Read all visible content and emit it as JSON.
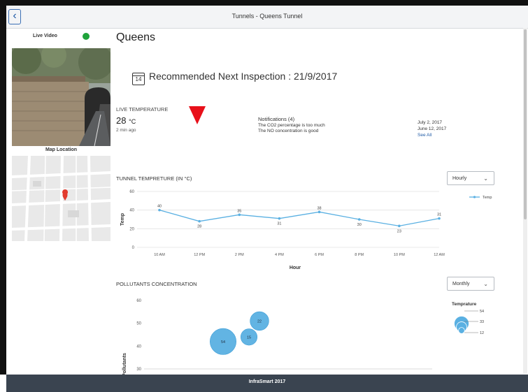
{
  "window": {
    "title": "Tunnels - Queens Tunnel",
    "back_icon": "chevron-left-icon"
  },
  "sidebar": {
    "live_video_label": "Live Video",
    "live_status_color": "#1fa33b",
    "map_label": "Map Location"
  },
  "header": {
    "city": "Queens",
    "inspection": "Recommended Next Inspection : 21/9/2017",
    "calendar_day": "14"
  },
  "live_temperature": {
    "title": "LIVE TEMPERATURE",
    "value": "28",
    "unit": "°C",
    "updated": "2 min ago",
    "trend_icon": "down-arrow-icon",
    "trend_color": "#e8101a"
  },
  "notifications": {
    "title": "Notifications (4)",
    "items": [
      "The CO2 percentage is too much",
      "The NO concentration is good"
    ],
    "dates": [
      "July 2, 2017",
      "June 12, 2017"
    ],
    "see_all": "See All"
  },
  "temperature_chart": {
    "title": "TUNNEL TEMPRETURE (IN °C)",
    "dropdown": "Hourly"
  },
  "pollutants_chart": {
    "title": "POLLUTANTS CONCENTRATION",
    "dropdown": "Monthly"
  },
  "footer": {
    "text": "InfraSmart 2017"
  },
  "chart_data": [
    {
      "type": "line",
      "x": [
        "10 AM",
        "12 PM",
        "2 PM",
        "4 PM",
        "6 PM",
        "8 PM",
        "10 PM",
        "12 AM"
      ],
      "series": [
        {
          "name": "Temp",
          "values": [
            40,
            28,
            35,
            31,
            38,
            30,
            23,
            31
          ]
        }
      ],
      "xlabel": "Hour",
      "ylabel": "Temp",
      "yticks": [
        0,
        20,
        40,
        60
      ],
      "ylim": [
        0,
        60
      ],
      "grid": true,
      "legend": "top-right",
      "color": "#5ab0e2"
    },
    {
      "type": "scatter",
      "points": [
        {
          "x": 1,
          "y": 42,
          "size": 54,
          "label": "54"
        },
        {
          "x": 2,
          "y": 44,
          "size": 15,
          "label": "15"
        },
        {
          "x": 3,
          "y": 51,
          "size": 22,
          "label": "22"
        }
      ],
      "ylabel": "Pollutants",
      "yticks": [
        30,
        40,
        50,
        60
      ],
      "ylim": [
        30,
        60
      ],
      "legend_title": "Temprature",
      "legend_values": [
        "54",
        "33",
        "12"
      ],
      "color": "#5ab0e2"
    }
  ]
}
